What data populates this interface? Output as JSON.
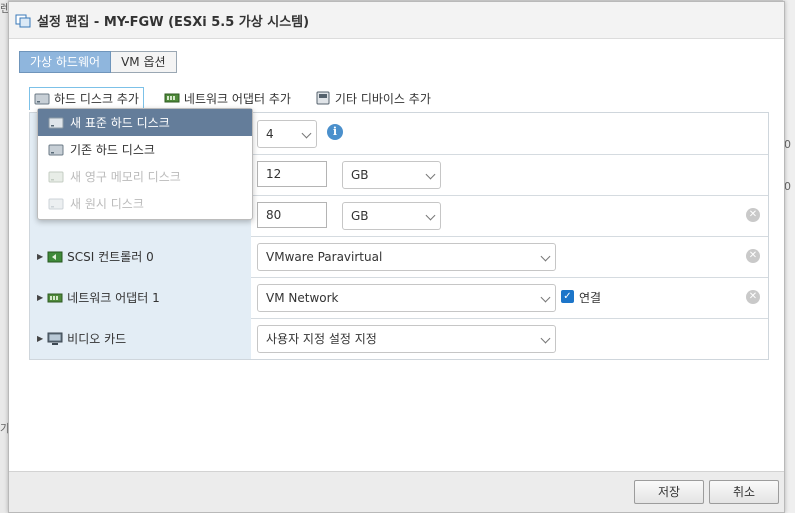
{
  "background_text": [
    "렌",
    "가",
    "0",
    "0"
  ],
  "window": {
    "title": "설정 편집 - MY-FGW (ESXi 5.5 가상 시스템)"
  },
  "tabs": [
    {
      "label": "가상 하드웨어",
      "active": true
    },
    {
      "label": "VM 옵션",
      "active": false
    }
  ],
  "add_toolbar": {
    "hard_disk": "하드 디스크 추가",
    "network": "네트워크 어댑터 추가",
    "other": "기타 디바이스 추가"
  },
  "dropdown_menu": [
    {
      "label": "새 표준 하드 디스크",
      "state": "selected"
    },
    {
      "label": "기존 하드 디스크",
      "state": "enabled"
    },
    {
      "label": "새 영구 메모리 디스크",
      "state": "disabled"
    },
    {
      "label": "새 원시 디스크",
      "state": "disabled"
    }
  ],
  "rows": {
    "cpu": {
      "value": "4"
    },
    "memory": {
      "value": "12",
      "unit": "GB"
    },
    "disk": {
      "value": "80",
      "unit": "GB"
    },
    "scsi": {
      "label": "SCSI 컨트롤러 0",
      "value": "VMware Paravirtual"
    },
    "network": {
      "label": "네트워크 어댑터 1",
      "value": "VM Network",
      "connect_label": "연결",
      "connected": true
    },
    "video": {
      "label": "비디오 카드",
      "value": "사용자 지정 설정 지정"
    }
  },
  "footer": {
    "save": "저장",
    "cancel": "취소"
  },
  "colors": {
    "tab_active": "#8fb6dd",
    "menu_selected": "#647d9a",
    "label_cell": "#e3edf5",
    "accent": "#1c75c9"
  }
}
